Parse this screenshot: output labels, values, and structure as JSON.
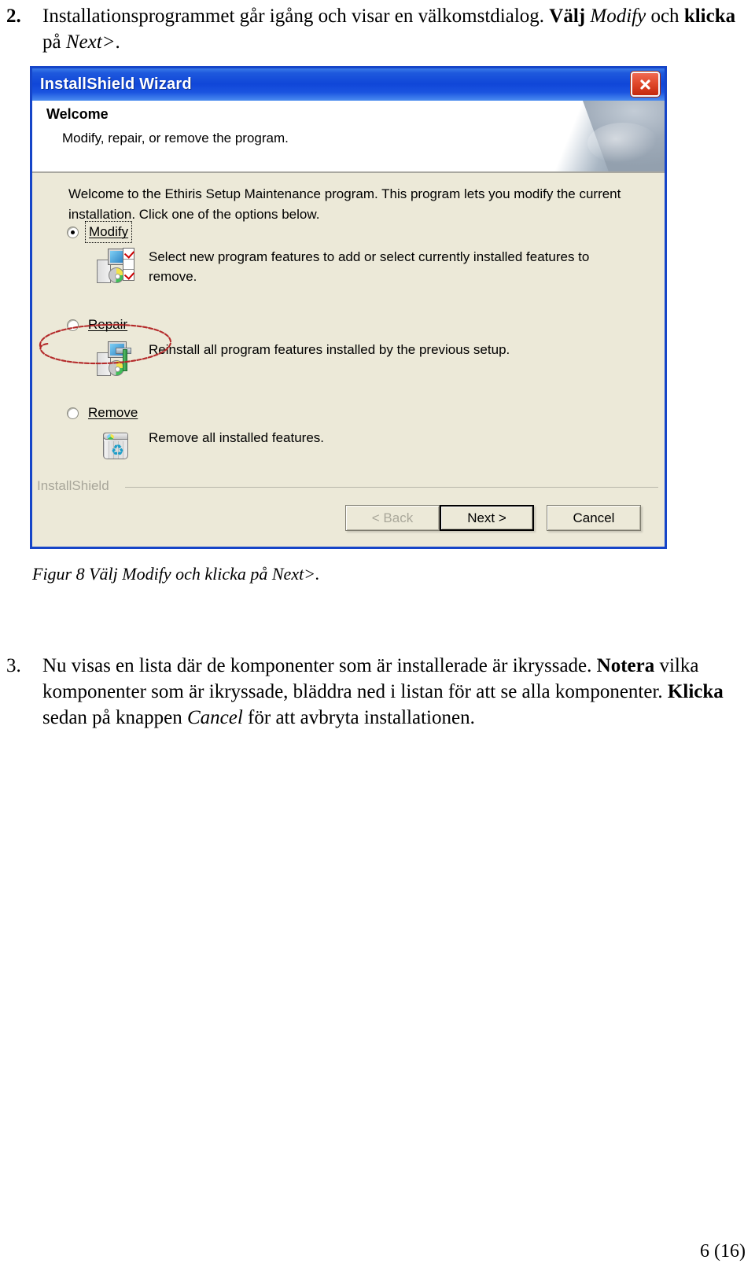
{
  "document": {
    "steps": [
      {
        "number": "2.",
        "line1_a": "Installationsprogrammet går igång och visar en välkomstdialog. ",
        "line1_bold": "Välj ",
        "line1_italic": "Modify",
        "line1_b": " och ",
        "line2_bold": "klicka",
        "line2_a": " på ",
        "line2_italic": "Next>",
        "line2_b": "."
      },
      {
        "number": "3.",
        "p_a": "Nu visas en lista där de komponenter som är installerade är ikryssade. ",
        "p_bold1": "Notera",
        "p_b": " vilka komponenter som är ikryssade, bläddra ned i listan för att se alla komponenter. ",
        "p_bold2": "Klicka",
        "p_c": " sedan på knappen ",
        "p_italic": "Cancel",
        "p_d": " för att avbryta installationen."
      }
    ],
    "figure_caption": "Figur 8 Välj Modify och klicka på Next>.",
    "page_number": "6 (16)"
  },
  "dialog": {
    "title": "InstallShield Wizard",
    "close_icon": "close-icon",
    "header": {
      "title": "Welcome",
      "subtitle": "Modify, repair, or remove the program."
    },
    "intro": "Welcome to the Ethiris Setup Maintenance program. This program lets you modify the current installation. Click one of the options below.",
    "options": [
      {
        "id": "modify",
        "label": "Modify",
        "selected": true,
        "focused": true,
        "description": "Select new program features to add or select currently installed features to remove.",
        "icon": "modify-features-icon"
      },
      {
        "id": "repair",
        "label": "Repair",
        "selected": false,
        "focused": false,
        "description": "Reinstall all program features installed by the previous setup.",
        "icon": "repair-computer-icon"
      },
      {
        "id": "remove",
        "label": "Remove",
        "selected": false,
        "focused": false,
        "description": "Remove all installed features.",
        "icon": "recycle-bin-icon"
      }
    ],
    "brand": "InstallShield",
    "buttons": {
      "back": "< Back",
      "next": "Next >",
      "cancel": "Cancel"
    }
  },
  "annotation": {
    "type": "hand-drawn-ellipse",
    "color": "#b42a2a",
    "target": "Modify radio option"
  },
  "colors": {
    "titlebar_blue": "#1046d8",
    "dialog_border": "#1645c8",
    "dialog_face": "#ece9d8",
    "close_red": "#c3280d",
    "annotation_red": "#b42a2a",
    "brand_grey": "#a8a69a"
  }
}
